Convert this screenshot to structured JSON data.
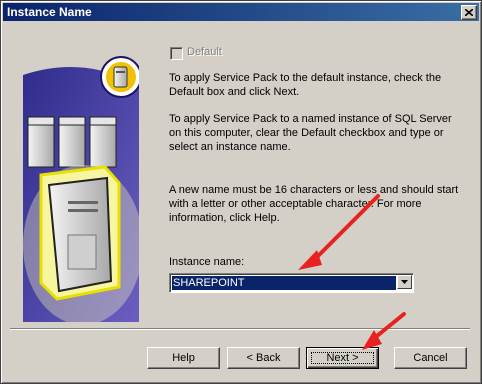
{
  "window": {
    "title": "Instance Name"
  },
  "default_checkbox": {
    "label": "Default",
    "checked": false,
    "enabled": false
  },
  "paragraphs": {
    "p1": "To apply Service Pack to the default instance,  check the Default box and click Next.",
    "p2": "To apply Service Pack to a named instance of SQL Server on this computer, clear the Default checkbox and type or select an instance name.",
    "p3": "A new name must be 16 characters or less and should start with a letter or other acceptable character. For more information, click Help."
  },
  "instance": {
    "label": "Instance name:",
    "value": "SHAREPOINT"
  },
  "buttons": {
    "help": "Help",
    "back": "< Back",
    "next": "Next >",
    "cancel": "Cancel"
  },
  "icons": {
    "close": "close-icon",
    "dropdown": "chevron-down-icon",
    "server": "server-icon",
    "annotation": "red-arrow-icon"
  },
  "colors": {
    "titlebar": "#0a246a",
    "selection": "#0a246a",
    "annotation_arrow": "#e8231f",
    "art_background": "#4a3f9e"
  }
}
